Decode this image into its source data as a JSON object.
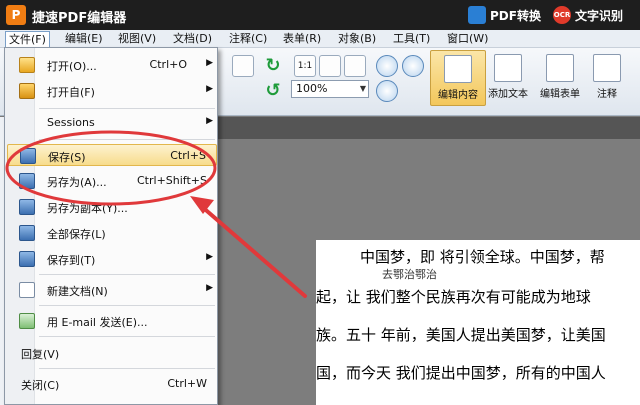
{
  "app": {
    "logo_glyph": "P",
    "title": "捷速PDF编辑器",
    "pdf_convert_label": "PDF转换",
    "ocr_icon_text": "OCR",
    "ocr_label": "文字识别"
  },
  "menubar": [
    "文件(F)",
    "编辑(E)",
    "视图(V)",
    "文档(D)",
    "注释(C)",
    "表单(R)",
    "对象(B)",
    "工具(T)",
    "窗口(W)"
  ],
  "toolbar": {
    "zoom_value": "100%",
    "fit_label": "1:1",
    "big_tools": [
      "编辑内容",
      "添加文本",
      "编辑表单",
      "注释"
    ]
  },
  "file_menu": {
    "items": [
      {
        "label": "打开(O)...",
        "shortcut": "Ctrl+O",
        "submenu": true,
        "icon": "folder-open-icon"
      },
      {
        "label": "打开自(F)",
        "shortcut": "",
        "submenu": true,
        "icon": "folder-icon"
      },
      {
        "label": "Sessions",
        "shortcut": "",
        "submenu": true,
        "icon": ""
      },
      {
        "label": "保存(S)",
        "shortcut": "Ctrl+S",
        "submenu": false,
        "icon": "save-icon"
      },
      {
        "label": "另存为(A)...",
        "shortcut": "Ctrl+Shift+S",
        "submenu": false,
        "icon": "save-as-icon"
      },
      {
        "label": "另存为副本(Y)...",
        "shortcut": "",
        "submenu": false,
        "icon": "save-copy-icon"
      },
      {
        "label": "全部保存(L)",
        "shortcut": "",
        "submenu": false,
        "icon": "save-all-icon"
      },
      {
        "label": "保存到(T)",
        "shortcut": "",
        "submenu": true,
        "icon": "save-to-icon"
      },
      {
        "label": "新建文档(N)",
        "shortcut": "",
        "submenu": true,
        "icon": "new-document-icon"
      },
      {
        "label": "用 E-mail 发送(E)...",
        "shortcut": "",
        "submenu": false,
        "icon": "email-icon"
      },
      {
        "label": "回复(V)",
        "shortcut": "",
        "submenu": false,
        "icon": ""
      },
      {
        "label": "关闭(C)",
        "shortcut": "Ctrl+W",
        "submenu": false,
        "icon": ""
      }
    ]
  },
  "document": {
    "lines": [
      "中国梦，即 将引领全球。中国梦，帮",
      "起，让 我们整个民族再次有可能成为地球",
      "族。五十 年前，美国人提出美国梦，让美国",
      "国，而今天 我们提出中国梦，所有的中国人"
    ],
    "note": "去鄂治鄂治"
  },
  "colors": {
    "highlight_ring": "#e0393b",
    "arrow": "#e0393b",
    "selection": "#f7dc8c"
  }
}
